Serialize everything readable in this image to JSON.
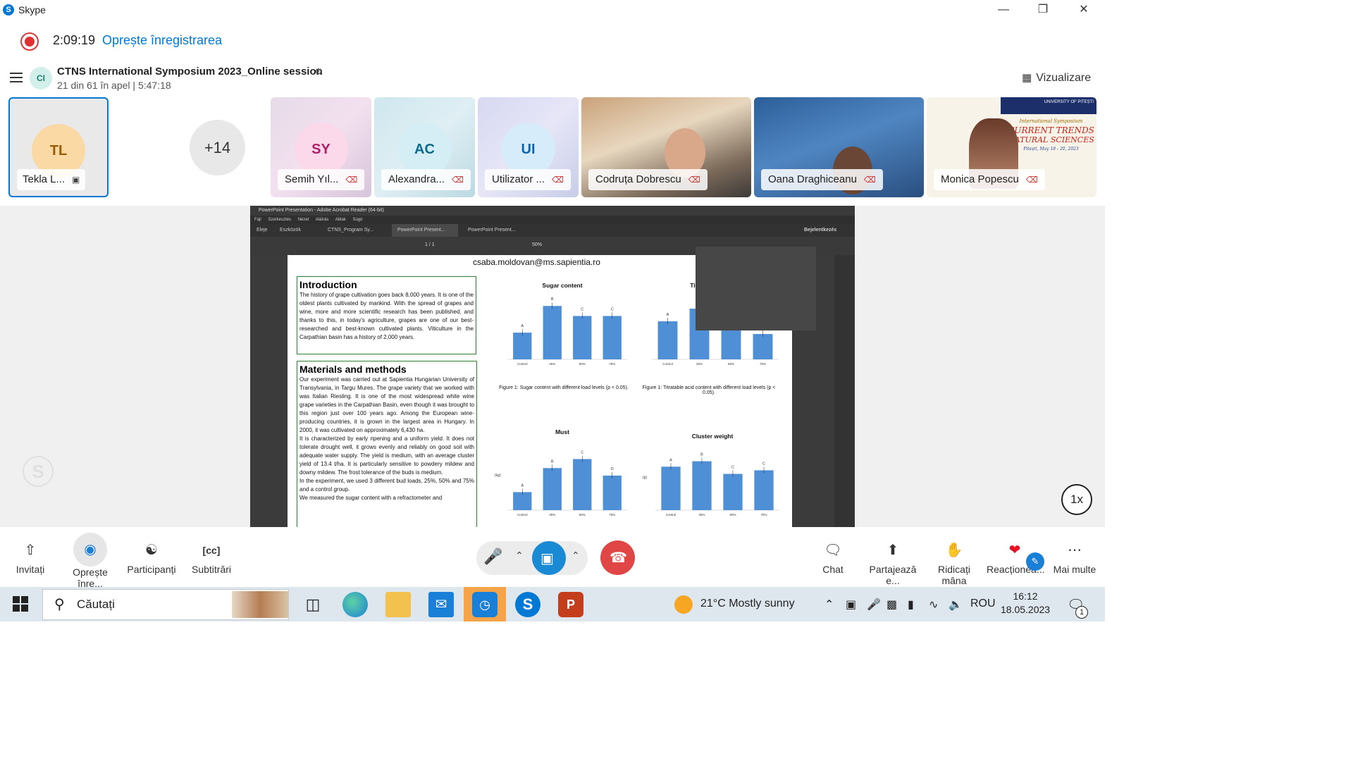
{
  "window": {
    "app_name": "Skype"
  },
  "recording": {
    "time": "2:09:19",
    "stop_label": "Oprește înregistrarea"
  },
  "conversation": {
    "avatar": "CI",
    "title": "CTNS International Symposium 2023_Online session",
    "subtitle": "21 din 61 în apel | 5:47:18",
    "view_label": "Vizualizare"
  },
  "participants": [
    {
      "initials": "TL",
      "name": "Tekla L..."
    },
    {
      "count": "+14"
    },
    {
      "initials": "SY",
      "name": "Semih Yıl..."
    },
    {
      "initials": "AC",
      "name": "Alexandra..."
    },
    {
      "initials": "UI",
      "name": "Utilizator ..."
    },
    {
      "name": "Codruța Dobrescu"
    },
    {
      "name": "Oana Draghiceanu"
    },
    {
      "name": "Monica Popescu",
      "banner_lines": [
        "UNIVERSITY OF PITEȘTI",
        "International Symposium",
        "CURRENT TRENDS",
        "NATURAL SCIENCES",
        "Pitești, May 18 - 20, 2023"
      ]
    }
  ],
  "acrobat": {
    "title": "PowerPoint Presentation - Adobe Acrobat Reader (64-bit)",
    "menu": [
      "Fájl",
      "Szerkesztés",
      "Nézet",
      "Aláírás",
      "Ablak",
      "Súgó"
    ],
    "tabs": [
      "Eleje",
      "Eszközök",
      "CTNS_Program Sy...",
      "PowerPoint Present...",
      "PowerPoint Present..."
    ],
    "signin": "Bejelentkezés",
    "page_counter": "1 / 1",
    "zoom": "50%"
  },
  "slide": {
    "email": "csaba.moldovan@ms.sapientia.ro",
    "intro_title": "Introduction",
    "intro_text": "The history of grape cultivation goes back 8,000 years. It is one of the oldest plants cultivated by mankind. With the spread of grapes and wine, more and more scientific research has been published, and thanks to this, in today's agriculture, grapes are one of our best-researched and best-known cultivated plants. Viticulture in the Carpathian basin has a history of 2,000 years.",
    "methods_title": "Materials and methods",
    "methods_p1": "Our experiment was carried out at Sapientia Hungarian University of Transylvania, in Targu Mures. The grape variety that we worked with was Italian Riesling. It is one of the most widespread white wine grape varieties in the Carpathian Basin, even though it was brought to this region just over 100 years ago. Among the European wine-producing countries, it is grown in the largest area in Hungary. In 2000, it was cultivated on approximately 6,430 ha.",
    "methods_p2": "It is characterized by early ripening and a uniform yield. It does not tolerate drought well, it grows evenly and reliably on good soil with adequate water supply. The yield is medium, with an average cluster yield of 13.4 t/ha. It is particularly sensitive to powdery mildew and downy mildew. The frost tolerance of the buds is medium.",
    "methods_p3": "In the experiment, we used 3 different bud loads, 25%, 50% and 75% and a control group.",
    "methods_p4": "We measured the sugar content with a refractometer and",
    "fig1_caption": "Figure 1: Sugar content with different load levels (p < 0.05).",
    "fig2_caption": "Figure 1: Titratable acid content with different load levels (p < 0.05)."
  },
  "chart_data": [
    {
      "type": "bar",
      "title": "Sugar content",
      "categories": [
        "Control",
        "25%",
        "50%",
        "75%"
      ],
      "values": [
        21.3,
        22.1,
        21.8,
        21.8
      ],
      "labels": [
        "A",
        "B",
        "C",
        "C"
      ],
      "ylim": [
        20.5,
        22.4
      ]
    },
    {
      "type": "bar",
      "title": "Titratable acid",
      "categories": [
        "Control",
        "25%",
        "50%",
        "75%"
      ],
      "values": [
        9.2,
        9.4,
        9.1,
        9.0
      ],
      "labels": [
        "A",
        "",
        "",
        ""
      ],
      "ylim": [
        8.6,
        9.6
      ]
    },
    {
      "type": "bar",
      "title": "Must",
      "categories": [
        "Control",
        "25%",
        "50%",
        "75%"
      ],
      "values": [
        1.2,
        2.8,
        3.4,
        2.3
      ],
      "labels": [
        "A",
        "B",
        "C",
        "D"
      ],
      "ylabel": "(kg)",
      "ylim": [
        0,
        4.5
      ]
    },
    {
      "type": "bar",
      "title": "Cluster weight",
      "categories": [
        "Control",
        "25%",
        "50%",
        "75%"
      ],
      "values": [
        24,
        27,
        20,
        22
      ],
      "labels": [
        "A",
        "B",
        "C",
        "C"
      ],
      "ylabel": "(g)",
      "ylim": [
        0,
        35
      ]
    }
  ],
  "controls": {
    "speed": "1x",
    "invite": "Invitați",
    "stop_rec": "Oprește înre...",
    "participants": "Participanți",
    "subtitles": "Subtitrări",
    "chat": "Chat",
    "share": "Partajează e...",
    "raise_hand": "Ridicați mâna",
    "react": "Reacționea...",
    "more": "Mai multe"
  },
  "taskbar": {
    "search_placeholder": "Căutați",
    "weather": "21°C  Mostly sunny",
    "lang": "ROU",
    "time": "16:12",
    "date": "18.05.2023",
    "notif_count": "1"
  },
  "colors": {
    "accent": "#0078d4",
    "recording": "#e03131",
    "hangup": "#e04646",
    "camera": "#1a8ad4",
    "chart_bar": "#4f8fd6"
  }
}
